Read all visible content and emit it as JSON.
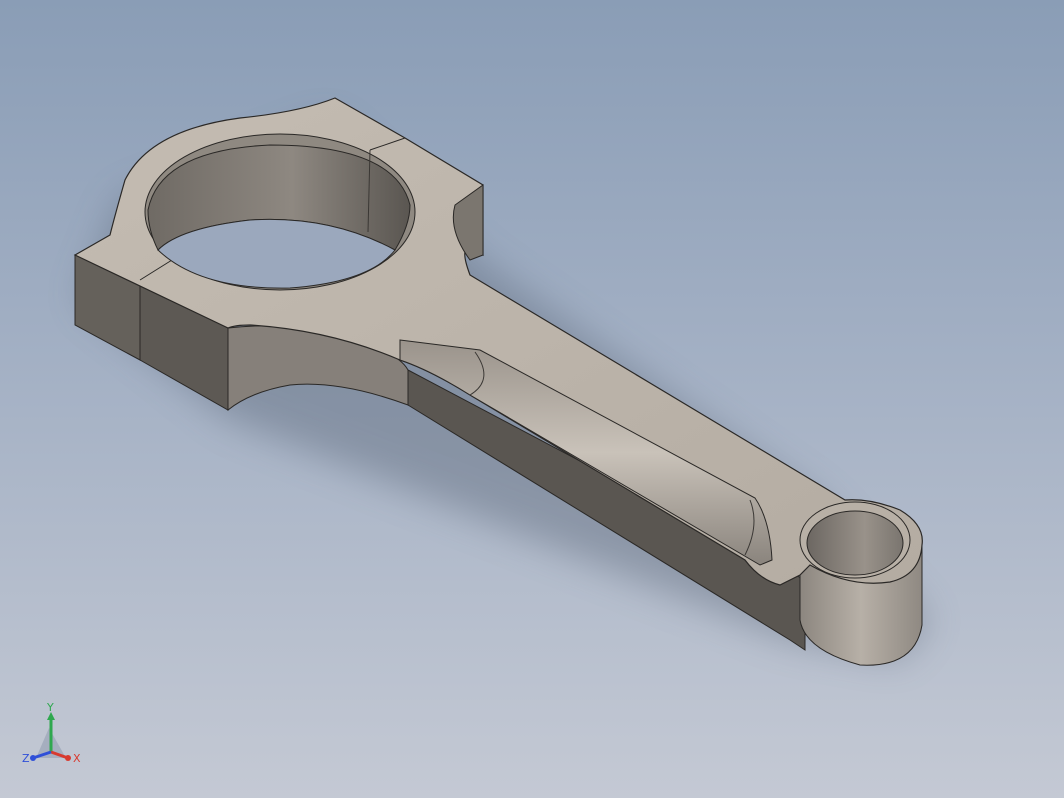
{
  "viewport": {
    "background_top": "#8a9db6",
    "background_bottom": "#c4c9d4",
    "part": "connecting-rod",
    "part_colors": {
      "top_face": "#b8b0a6",
      "side_light": "#8d8780",
      "side_dark": "#5e5a55",
      "edge": "#2a2826"
    }
  },
  "triad": {
    "labels": {
      "y": "Y",
      "z": "Z",
      "x": "X"
    },
    "colors": {
      "y": "#2fa84f",
      "z": "#2f4fd8",
      "x": "#d83a2f"
    }
  }
}
